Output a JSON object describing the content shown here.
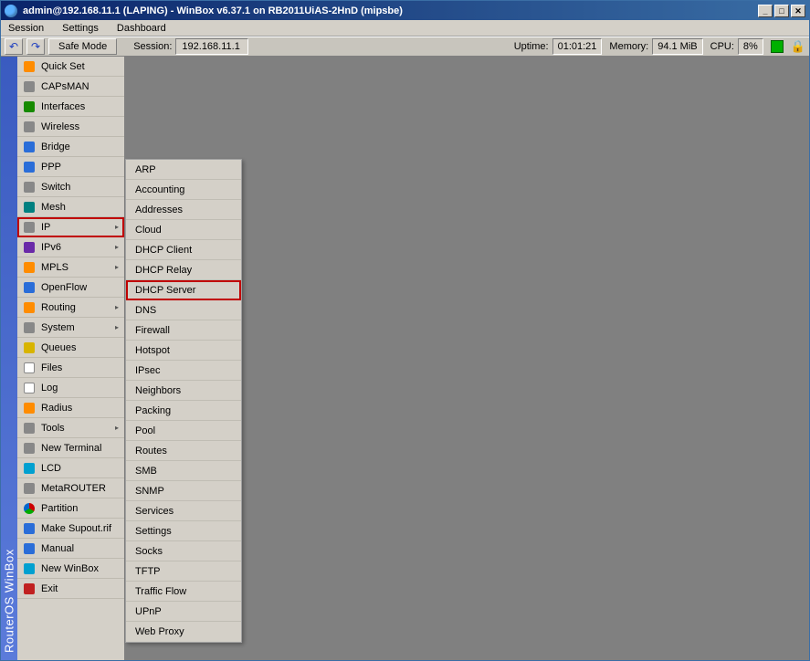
{
  "title": "admin@192.168.11.1 (LAPING) - WinBox v6.37.1 on RB2011UiAS-2HnD (mipsbe)",
  "menubar": {
    "session": "Session",
    "settings": "Settings",
    "dashboard": "Dashboard"
  },
  "toolbar": {
    "undo_glyph": "↶",
    "redo_glyph": "↷",
    "safe_mode": "Safe Mode",
    "session_label": "Session:",
    "session_value": "192.168.11.1",
    "uptime_label": "Uptime:",
    "uptime_value": "01:01:21",
    "memory_label": "Memory:",
    "memory_value": "94.1 MiB",
    "cpu_label": "CPU:",
    "cpu_value": "8%"
  },
  "brand": "RouterOS WinBox",
  "sidebar": [
    {
      "label": "Quick Set",
      "icon": "ico-orange",
      "arrow": false
    },
    {
      "label": "CAPsMAN",
      "icon": "ico-grey",
      "arrow": false
    },
    {
      "label": "Interfaces",
      "icon": "ico-green",
      "arrow": false
    },
    {
      "label": "Wireless",
      "icon": "ico-grey",
      "arrow": false
    },
    {
      "label": "Bridge",
      "icon": "ico-blue",
      "arrow": false
    },
    {
      "label": "PPP",
      "icon": "ico-blue",
      "arrow": false
    },
    {
      "label": "Switch",
      "icon": "ico-grey",
      "arrow": false
    },
    {
      "label": "Mesh",
      "icon": "ico-teal",
      "arrow": false
    },
    {
      "label": "IP",
      "icon": "ico-grey",
      "arrow": true,
      "hl": true
    },
    {
      "label": "IPv6",
      "icon": "ico-purple",
      "arrow": true
    },
    {
      "label": "MPLS",
      "icon": "ico-orange",
      "arrow": true
    },
    {
      "label": "OpenFlow",
      "icon": "ico-blue",
      "arrow": false
    },
    {
      "label": "Routing",
      "icon": "ico-orange",
      "arrow": true
    },
    {
      "label": "System",
      "icon": "ico-grey",
      "arrow": true
    },
    {
      "label": "Queues",
      "icon": "ico-yellow",
      "arrow": false
    },
    {
      "label": "Files",
      "icon": "ico-white",
      "arrow": false
    },
    {
      "label": "Log",
      "icon": "ico-white",
      "arrow": false
    },
    {
      "label": "Radius",
      "icon": "ico-orange",
      "arrow": false
    },
    {
      "label": "Tools",
      "icon": "ico-grey",
      "arrow": true
    },
    {
      "label": "New Terminal",
      "icon": "ico-grey",
      "arrow": false
    },
    {
      "label": "LCD",
      "icon": "ico-cyan",
      "arrow": false
    },
    {
      "label": "MetaROUTER",
      "icon": "ico-grey",
      "arrow": false
    },
    {
      "label": "Partition",
      "icon": "ico-pie",
      "arrow": false
    },
    {
      "label": "Make Supout.rif",
      "icon": "ico-blue",
      "arrow": false
    },
    {
      "label": "Manual",
      "icon": "ico-blue",
      "arrow": false
    },
    {
      "label": "New WinBox",
      "icon": "ico-cyan",
      "arrow": false
    },
    {
      "label": "Exit",
      "icon": "ico-red",
      "arrow": false
    }
  ],
  "submenu": [
    {
      "label": "ARP"
    },
    {
      "label": "Accounting"
    },
    {
      "label": "Addresses"
    },
    {
      "label": "Cloud"
    },
    {
      "label": "DHCP Client"
    },
    {
      "label": "DHCP Relay"
    },
    {
      "label": "DHCP Server",
      "hl": true
    },
    {
      "label": "DNS"
    },
    {
      "label": "Firewall"
    },
    {
      "label": "Hotspot"
    },
    {
      "label": "IPsec"
    },
    {
      "label": "Neighbors"
    },
    {
      "label": "Packing"
    },
    {
      "label": "Pool"
    },
    {
      "label": "Routes"
    },
    {
      "label": "SMB"
    },
    {
      "label": "SNMP"
    },
    {
      "label": "Services"
    },
    {
      "label": "Settings"
    },
    {
      "label": "Socks"
    },
    {
      "label": "TFTP"
    },
    {
      "label": "Traffic Flow"
    },
    {
      "label": "UPnP"
    },
    {
      "label": "Web Proxy"
    }
  ],
  "winctl": {
    "min": "_",
    "max": "□",
    "close": "✕"
  }
}
